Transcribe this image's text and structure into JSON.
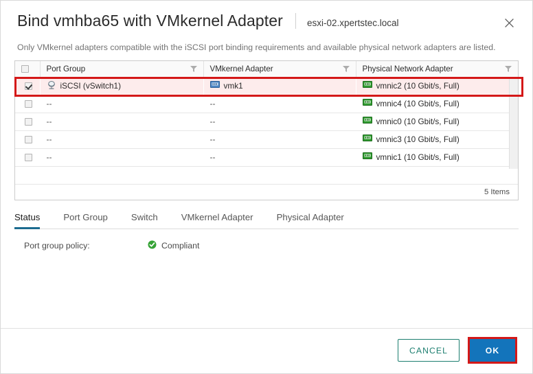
{
  "dialog": {
    "title": "Bind vmhba65 with VMkernel Adapter",
    "subtitle": "esxi-02.xpertstec.local",
    "close_icon": "close-icon",
    "description": "Only VMkernel adapters compatible with the iSCSI port binding requirements and available physical network adapters are listed."
  },
  "table": {
    "columns": [
      {
        "label": "Port Group",
        "filter_icon": "filter-icon"
      },
      {
        "label": "VMkernel Adapter",
        "filter_icon": "filter-icon"
      },
      {
        "label": "Physical Network Adapter",
        "filter_icon": "filter-icon"
      }
    ],
    "rows": [
      {
        "checked": true,
        "selected": true,
        "port_group": "iSCSI (vSwitch1)",
        "port_group_icon": "port-group-icon",
        "vmkernel_adapter": "vmk1",
        "vmkernel_icon": "vmkernel-adapter-icon",
        "physical_adapter": "vmnic2 (10 Gbit/s, Full)",
        "physical_icon": "physical-nic-icon"
      },
      {
        "checked": false,
        "selected": false,
        "port_group": "--",
        "vmkernel_adapter": "--",
        "physical_adapter": "vmnic4 (10 Gbit/s, Full)",
        "physical_icon": "physical-nic-icon"
      },
      {
        "checked": false,
        "selected": false,
        "port_group": "--",
        "vmkernel_adapter": "--",
        "physical_adapter": "vmnic0 (10 Gbit/s, Full)",
        "physical_icon": "physical-nic-icon"
      },
      {
        "checked": false,
        "selected": false,
        "port_group": "--",
        "vmkernel_adapter": "--",
        "physical_adapter": "vmnic3 (10 Gbit/s, Full)",
        "physical_icon": "physical-nic-icon"
      },
      {
        "checked": false,
        "selected": false,
        "port_group": "--",
        "vmkernel_adapter": "--",
        "physical_adapter": "vmnic1 (10 Gbit/s, Full)",
        "physical_icon": "physical-nic-icon"
      }
    ],
    "item_count_label": "5 Items"
  },
  "tabs": [
    {
      "label": "Status",
      "active": true
    },
    {
      "label": "Port Group",
      "active": false
    },
    {
      "label": "Switch",
      "active": false
    },
    {
      "label": "VMkernel Adapter",
      "active": false
    },
    {
      "label": "Physical Adapter",
      "active": false
    }
  ],
  "status": {
    "label": "Port group policy:",
    "value": "Compliant",
    "value_icon": "compliant-check-icon"
  },
  "footer": {
    "cancel_label": "CANCEL",
    "ok_label": "OK"
  },
  "colors": {
    "annotation_red": "#d41818",
    "ok_blue": "#1374bb",
    "cancel_green": "#1a7d6e",
    "active_tab_underline": "#1b6b8f",
    "compliant_green": "#36a336",
    "selected_row_bg": "#fdecec"
  }
}
